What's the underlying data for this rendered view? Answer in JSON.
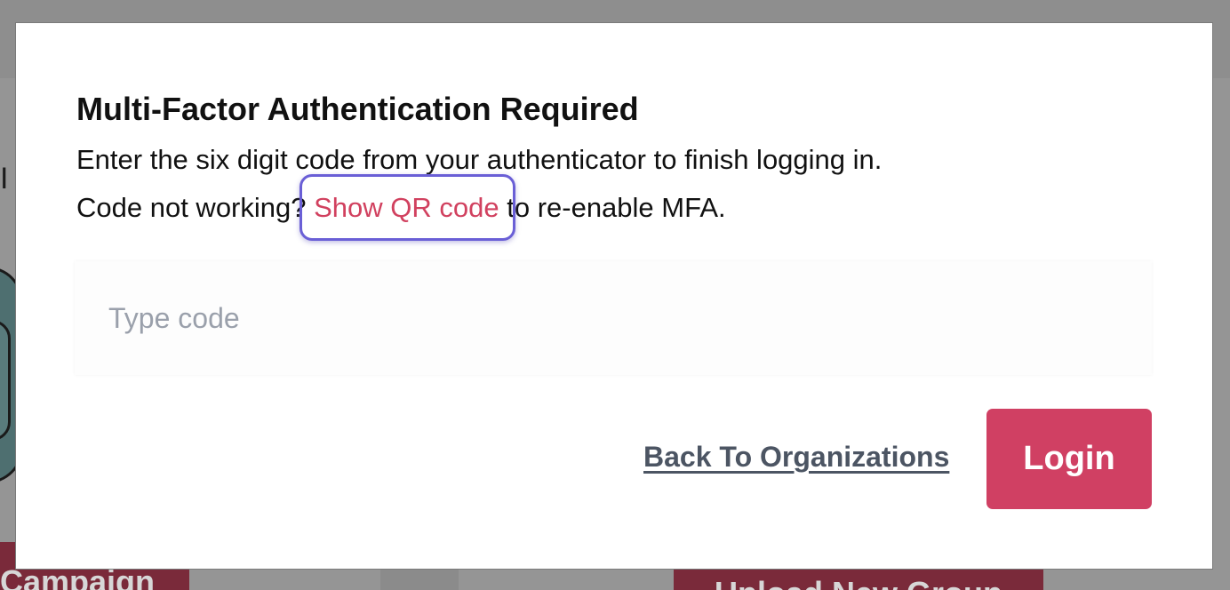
{
  "background": {
    "left_button_label": "Campaign",
    "right_button_label": "Upload New Group"
  },
  "modal": {
    "title": "Multi-Factor Authentication Required",
    "description": "Enter the six digit code from your authenticator to finish logging in.",
    "help_prefix": "Code not working? ",
    "help_link": "Show QR code",
    "help_suffix": " to re-enable MFA.",
    "code_input": {
      "value": "",
      "placeholder": "Type code"
    },
    "back_link": "Back To Organizations",
    "login_button": "Login"
  },
  "colors": {
    "accent": "#d04063",
    "link": "#d1415f",
    "focus_ring": "#6a5fd6",
    "overlay": "#959595"
  }
}
